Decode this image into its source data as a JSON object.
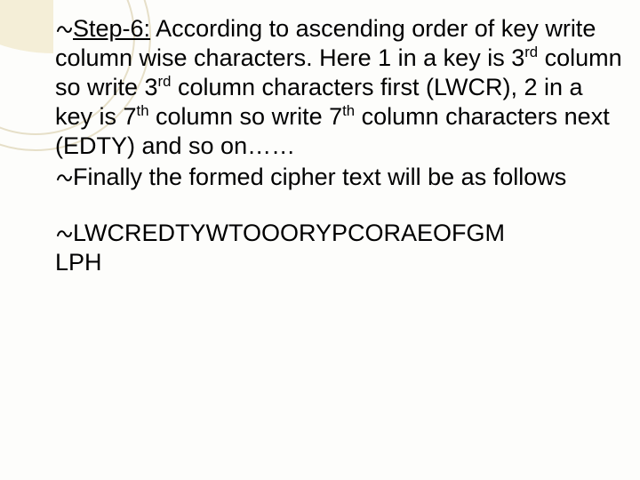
{
  "bullets": {
    "b1": "\u0016",
    "b2": "\u0016",
    "b3": "\u0016"
  },
  "para1": {
    "step_label": "Step-6:",
    "t1": " According to ascending order of key write column wise characters. Here 1 in a key is 3",
    "sup1": "rd",
    "t2": " column so write 3",
    "sup2": "rd",
    "t3": " column characters first (LWCR), 2 in a key is 7",
    "sup3": "th",
    "t4": " column so write 7",
    "sup4": "th",
    "t5": " column characters next (EDTY) and so on……"
  },
  "para2": {
    "text": "Finally the formed cipher text will be as follows"
  },
  "para3": {
    "line1": "LWCREDTYWTOOORYPCORAEOFGM",
    "line2": "LPH"
  }
}
